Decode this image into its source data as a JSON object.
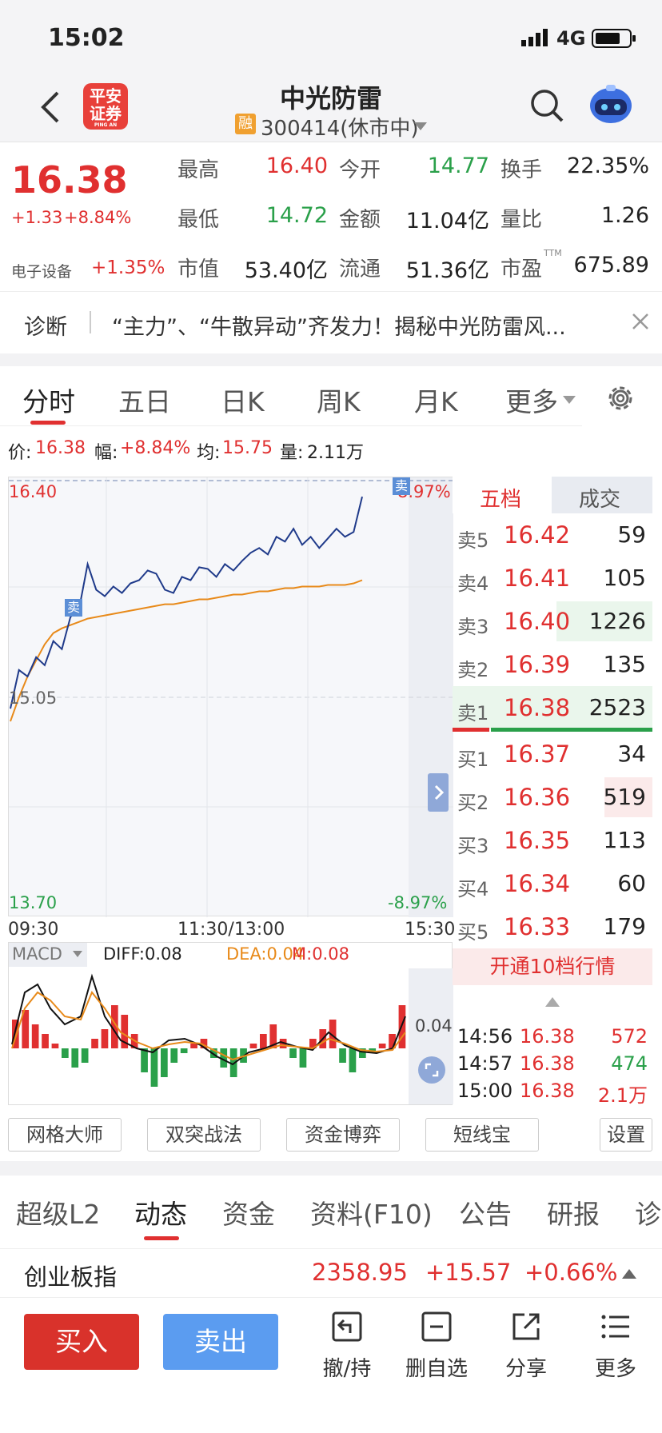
{
  "status": {
    "time": "15:02",
    "network": "4G"
  },
  "nav": {
    "stock_name": "中光防雷",
    "rong_badge": "融",
    "code_status": "300414(休市中)",
    "logo_line1": "平安",
    "logo_line2": "证券",
    "logo_sub": "PING AN"
  },
  "quote": {
    "price": "16.38",
    "change": "+1.33",
    "change_pct": "+8.84%",
    "sector": "电子设备",
    "sector_pct": "+1.35%",
    "high_label": "最高",
    "high": "16.40",
    "open_label": "今开",
    "open": "14.77",
    "turnover_label": "换手",
    "turnover": "22.35%",
    "low_label": "最低",
    "low": "14.72",
    "amount_label": "金额",
    "amount": "11.04亿",
    "vol_ratio_label": "量比",
    "vol_ratio": "1.26",
    "mcap_label": "市值",
    "mcap": "53.40亿",
    "float_label": "流通",
    "float": "51.36亿",
    "pe_label": "市盈",
    "pe_sup": "TTM",
    "pe": "675.89"
  },
  "diagnosis": {
    "label": "诊断",
    "text": "“主力”、“牛散异动”齐发力！揭秘中光防雷风..."
  },
  "tabs": {
    "t1": "分时",
    "t2": "五日",
    "t3": "日K",
    "t4": "周K",
    "t5": "月K",
    "t6": "更多"
  },
  "info": {
    "price_label": "价:",
    "price": "16.38",
    "amp_label": "幅:",
    "amp": "+8.84%",
    "avg_label": "均:",
    "avg": "15.75",
    "vol_label": "量:",
    "vol": "2.11万"
  },
  "chart_data": {
    "type": "line",
    "y_top": "16.40",
    "y_mid": "15.05",
    "y_bottom": "13.70",
    "pct_top": "8.97%",
    "pct_bottom": "-8.97%",
    "x_start": "09:30",
    "x_mid": "11:30/13:00",
    "x_end": "15:30",
    "sell_marker": "卖",
    "ylim": [
      13.7,
      16.4
    ],
    "series": [
      {
        "name": "价",
        "values": [
          14.98,
          15.22,
          15.18,
          15.3,
          15.25,
          15.4,
          15.35,
          15.55,
          15.6,
          15.88,
          15.72,
          15.68,
          15.74,
          15.7,
          15.76,
          15.78,
          15.84,
          15.82,
          15.72,
          15.7,
          15.8,
          15.78,
          15.86,
          15.85,
          15.8,
          15.88,
          15.84,
          15.9,
          15.95,
          15.98,
          15.94,
          16.05,
          16.02,
          16.1,
          16.0,
          16.05,
          15.98,
          16.04,
          16.1,
          16.05,
          16.08,
          16.3
        ]
      },
      {
        "name": "均",
        "values": [
          14.9,
          15.05,
          15.18,
          15.28,
          15.38,
          15.45,
          15.48,
          15.5,
          15.52,
          15.54,
          15.55,
          15.56,
          15.57,
          15.58,
          15.59,
          15.6,
          15.61,
          15.62,
          15.63,
          15.63,
          15.64,
          15.65,
          15.66,
          15.66,
          15.67,
          15.68,
          15.69,
          15.69,
          15.7,
          15.71,
          15.71,
          15.72,
          15.73,
          15.73,
          15.74,
          15.74,
          15.74,
          15.75,
          15.75,
          15.75,
          15.76,
          15.78
        ]
      }
    ]
  },
  "macd": {
    "label": "MACD",
    "diff": "DIFF:0.08",
    "dea": "DEA:0.04",
    "m": "M:0.08",
    "right_val": "0.04",
    "bars": [
      0.6,
      0.8,
      0.5,
      0.3,
      0.1,
      -0.2,
      -0.4,
      -0.3,
      0.2,
      0.4,
      0.9,
      0.7,
      0.3,
      -0.5,
      -0.8,
      -0.6,
      -0.3,
      -0.1,
      0.1,
      0.2,
      -0.2,
      -0.4,
      -0.6,
      -0.3,
      0.1,
      0.3,
      0.5,
      0.2,
      -0.2,
      -0.4,
      0.2,
      0.4,
      0.6,
      -0.3,
      -0.5,
      -0.2,
      -0.1,
      0.1,
      0.3,
      0.9
    ]
  },
  "orderbook": {
    "tab1": "五档",
    "tab2": "成交",
    "asks": [
      {
        "label": "卖5",
        "price": "16.42",
        "vol": "59"
      },
      {
        "label": "卖4",
        "price": "16.41",
        "vol": "105"
      },
      {
        "label": "卖3",
        "price": "16.40",
        "vol": "1226"
      },
      {
        "label": "卖2",
        "price": "16.39",
        "vol": "135"
      },
      {
        "label": "卖1",
        "price": "16.38",
        "vol": "2523"
      }
    ],
    "bids": [
      {
        "label": "买1",
        "price": "16.37",
        "vol": "34"
      },
      {
        "label": "买2",
        "price": "16.36",
        "vol": "519"
      },
      {
        "label": "买3",
        "price": "16.35",
        "vol": "113"
      },
      {
        "label": "买4",
        "price": "16.34",
        "vol": "60"
      },
      {
        "label": "买5",
        "price": "16.33",
        "vol": "179"
      }
    ],
    "upgrade": "开通10档行情",
    "trades": [
      {
        "time": "14:56",
        "price": "16.38",
        "vol": "572"
      },
      {
        "time": "14:57",
        "price": "16.38",
        "vol": "474"
      },
      {
        "time": "15:00",
        "price": "16.38",
        "vol": "2.1万"
      }
    ]
  },
  "tools": {
    "b1": "网格大师",
    "b2": "双突战法",
    "b3": "资金博弈",
    "b4": "短线宝",
    "b5": "设置"
  },
  "btabs": {
    "t1": "超级L2",
    "t2": "动态",
    "t3": "资金",
    "t4": "资料(F10)",
    "t5": "公告",
    "t6": "研报",
    "t7": "诊"
  },
  "ticker": {
    "name": "创业板指",
    "value": "2358.95",
    "change": "+15.57",
    "pct": "+0.66%"
  },
  "bottom": {
    "buy": "买入",
    "sell": "卖出",
    "b1": "撤/持",
    "b2": "删自选",
    "b3": "分享",
    "b4": "更多"
  },
  "colors": {
    "red": "#e03030",
    "green": "#2aa04a",
    "blue": "#5b9cf0",
    "price_line": "#1f3a8a",
    "avg_line": "#e88a1a"
  }
}
